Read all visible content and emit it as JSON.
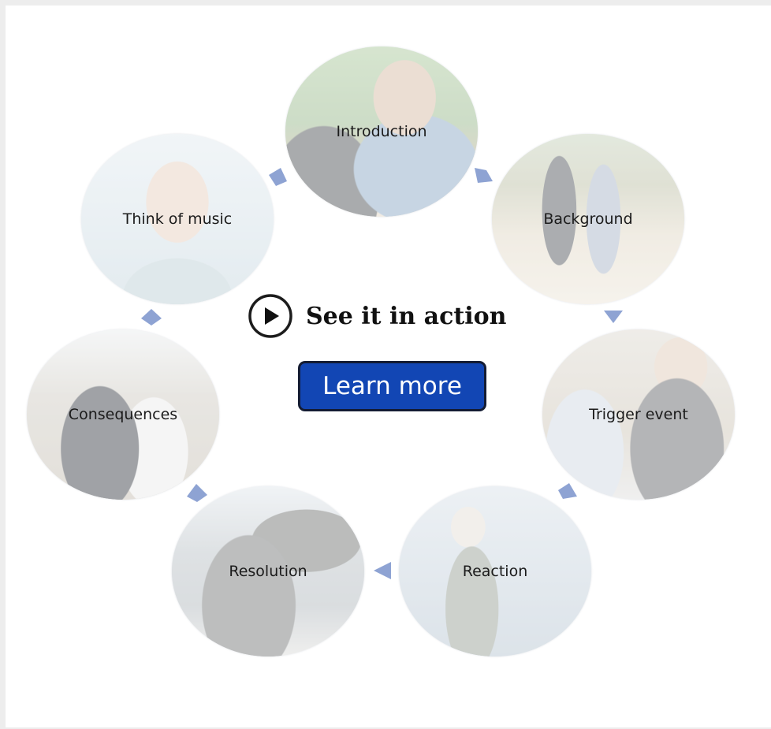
{
  "cycle": {
    "steps": [
      {
        "id": "introduction",
        "label": "Introduction"
      },
      {
        "id": "background",
        "label": "Background"
      },
      {
        "id": "trigger-event",
        "label": "Trigger event"
      },
      {
        "id": "reaction",
        "label": "Reaction"
      },
      {
        "id": "resolution",
        "label": "Resolution"
      },
      {
        "id": "consequences",
        "label": "Consequences"
      },
      {
        "id": "think-of-music",
        "label": "Think of music"
      }
    ],
    "arrow_color": "#8ea3d3"
  },
  "cta": {
    "icon": "play-circle-icon",
    "text": "See it in action",
    "button_label": "Learn more",
    "button_color": "#1246b4"
  }
}
